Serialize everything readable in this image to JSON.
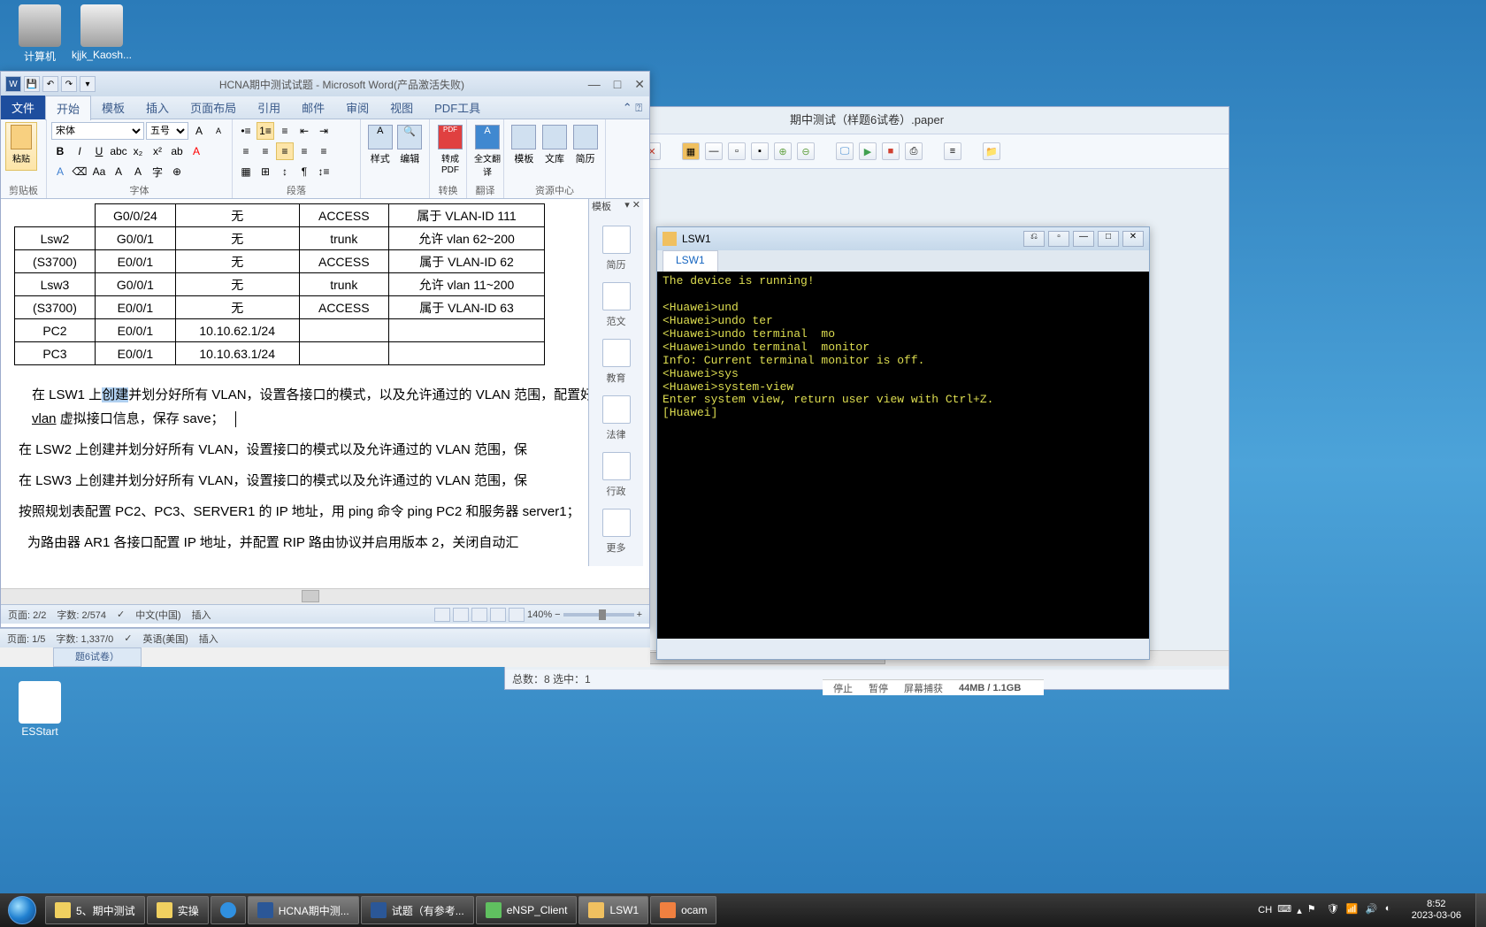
{
  "desktop": {
    "icons": {
      "computer": "计算机",
      "kjjk": "kjjk_Kaosh...",
      "esstart": "ESStart"
    }
  },
  "word": {
    "title": "HCNA期中测试试题 - Microsoft Word(产品激活失败)",
    "menu": {
      "file": "文件",
      "start": "开始",
      "template": "模板",
      "insert": "插入",
      "layout": "页面布局",
      "ref": "引用",
      "mail": "邮件",
      "review": "审阅",
      "view": "视图",
      "pdf": "PDF工具"
    },
    "ribbon": {
      "clipboard": "剪贴板",
      "paste": "粘贴",
      "font": "字体",
      "para": "段落",
      "style_btn": "样式",
      "edit_btn": "编辑",
      "convert_btn": "转成PDF",
      "convert": "转换",
      "translate_btn": "全文翻译",
      "translate": "翻译",
      "res_template": "模板",
      "res_lib": "文库",
      "res_resume": "简历",
      "res": "资源中心",
      "font_name": "宋体",
      "font_size": "五号"
    },
    "tpl_panel": {
      "header": "模板",
      "history": "简历",
      "sample": "范文",
      "edu": "教育",
      "law": "法律",
      "admin": "行政",
      "more": "更多"
    },
    "table": {
      "rows": [
        [
          "",
          "G0/0/24",
          "无",
          "ACCESS",
          "属于 VLAN-ID 111"
        ],
        [
          "Lsw2",
          "G0/0/1",
          "无",
          "trunk",
          "允许 vlan 62~200"
        ],
        [
          "(S3700)",
          "E0/0/1",
          "无",
          "ACCESS",
          "属于 VLAN-ID   62"
        ],
        [
          "Lsw3",
          "G0/0/1",
          "无",
          "trunk",
          "允许 vlan 11~200"
        ],
        [
          "(S3700)",
          "E0/0/1",
          "无",
          "ACCESS",
          "属于 VLAN-ID   63"
        ],
        [
          "PC2",
          "E0/0/1",
          "10.10.62.1/24",
          "",
          ""
        ],
        [
          "PC3",
          "E0/0/1",
          "10.10.63.1/24",
          "",
          ""
        ]
      ]
    },
    "paragraphs": {
      "p1a": "在 LSW1 上",
      "p1_hl": "创建",
      "p1b": "并划分好所有 VLAN，设置各接口的模式，以及允许通过的 VLAN 范围，配置好 ",
      "p1_u": "vlan",
      "p1c": " 虚拟接口信息，保存 save；",
      "p2": "在 LSW2 上创建并划分好所有 VLAN，设置接口的模式以及允许通过的 VLAN 范围，保",
      "p3": "在 LSW3 上创建并划分好所有 VLAN，设置接口的模式以及允许通过的 VLAN 范围，保",
      "p4": "按照规划表配置 PC2、PC3、SERVER1 的 IP 地址，用 ping 命令 ping PC2 和服务器 server1；",
      "p5": "为路由器 AR1 各接口配置 IP 地址，并配置 RIP 路由协议并启用版本 2，关闭自动汇"
    },
    "status": {
      "page": "页面: 2/2",
      "words": "字数: 2/574",
      "lang": "中文(中国)",
      "mode": "插入",
      "zoom": "140%"
    },
    "status2": {
      "page": "页面: 1/5",
      "words": "字数: 1,337/0",
      "lang": "英语(美国)",
      "mode": "插入",
      "tab": "题6试卷）"
    }
  },
  "paper": {
    "title": "期中测试（样题6试卷）.paper",
    "status": "总数：8  选中：1"
  },
  "terminal": {
    "title": "LSW1",
    "tab": "LSW1",
    "lines": "The device is running!\n\n<Huawei>und\n<Huawei>undo ter\n<Huawei>undo terminal  mo\n<Huawei>undo terminal  monitor\nInfo: Current terminal monitor is off.\n<Huawei>sys\n<Huawei>system-view\nEnter system view, return user view with Ctrl+Z.\n[Huawei]"
  },
  "ocam": {
    "stop": "停止",
    "pause": "暂停",
    "capture": "屏幕捕获",
    "mem": "44MB / 1.1GB"
  },
  "taskbar": {
    "items": [
      {
        "label": "5、期中测试"
      },
      {
        "label": "实操"
      },
      {
        "label": ""
      },
      {
        "label": "HCNA期中测..."
      },
      {
        "label": "试题（有参考..."
      },
      {
        "label": "eNSP_Client"
      },
      {
        "label": "LSW1"
      },
      {
        "label": "ocam"
      }
    ],
    "ime": "CH",
    "time": "8:52",
    "date": "2023-03-06"
  }
}
